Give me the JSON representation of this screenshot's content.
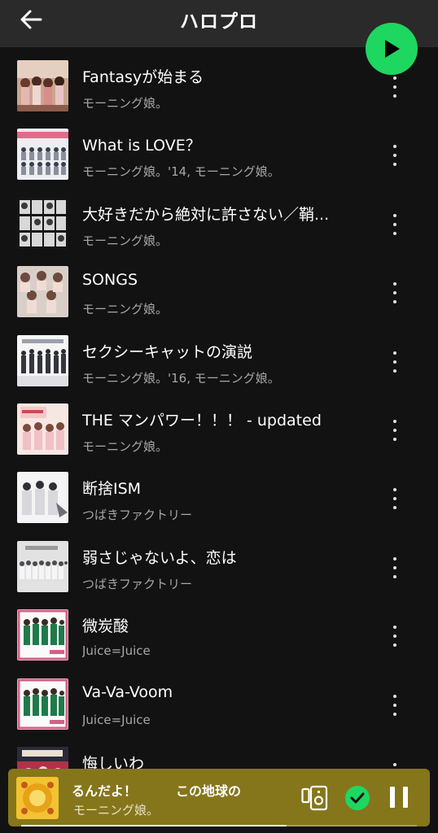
{
  "header": {
    "title": "ハロプロ",
    "back_icon": "arrow-left-icon",
    "play_icon": "play-icon",
    "play_color": "#1ed760"
  },
  "tracks": [
    {
      "title": "Fantasyが始まる",
      "subtitle": "モーニング娘。"
    },
    {
      "title": "What is LOVE？",
      "subtitle": "モーニング娘。'14, モーニング娘。"
    },
    {
      "title": "大好きだから絶対に許さない／鞘...",
      "subtitle": "モーニング娘。"
    },
    {
      "title": "SONGS",
      "subtitle": "モーニング娘。"
    },
    {
      "title": "セクシーキャットの演説",
      "subtitle": "モーニング娘。'16, モーニング娘。"
    },
    {
      "title": "THE マンパワー！！！ - updated",
      "subtitle": "モーニング娘。"
    },
    {
      "title": "断捨ISM",
      "subtitle": "つばきファクトリー"
    },
    {
      "title": "弱さじゃないよ、恋は",
      "subtitle": "つばきファクトリー"
    },
    {
      "title": "微炭酸",
      "subtitle": "Juice=Juice"
    },
    {
      "title": "Va-Va-Voom",
      "subtitle": "Juice=Juice"
    },
    {
      "title": "悔しいわ",
      "subtitle": ""
    }
  ],
  "player": {
    "title": "るんだよ！　　　この地球の",
    "subtitle": "モーニング娘。",
    "device_icon": "speaker-device-icon",
    "liked_icon": "check-circle-icon",
    "pause_icon": "pause-icon",
    "background": "#85761c",
    "progress": 0.67
  },
  "colors": {
    "background": "#121212",
    "accent": "#1ed760",
    "secondary_text": "#a7a7a7"
  }
}
